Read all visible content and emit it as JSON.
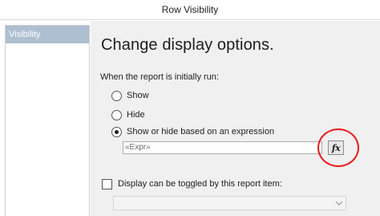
{
  "window": {
    "title": "Row Visibility"
  },
  "sidebar": {
    "items": [
      {
        "label": "Visibility"
      }
    ]
  },
  "main": {
    "heading": "Change display options.",
    "prompt": "When the report is initially run:",
    "options": [
      {
        "label": "Show",
        "checked": false
      },
      {
        "label": "Hide",
        "checked": false
      },
      {
        "label": "Show or hide based on an expression",
        "checked": true
      }
    ],
    "expression": {
      "value": "«Expr»",
      "button_label": "fx"
    },
    "toggle": {
      "label": "Display can be toggled by this report item:",
      "checked": false
    },
    "toggle_dropdown": {
      "value": ""
    }
  },
  "colors": {
    "sidebar_selected": "#aebfd2",
    "panel_background": "#f0f0f0",
    "highlight_ring": "#e8191a"
  }
}
